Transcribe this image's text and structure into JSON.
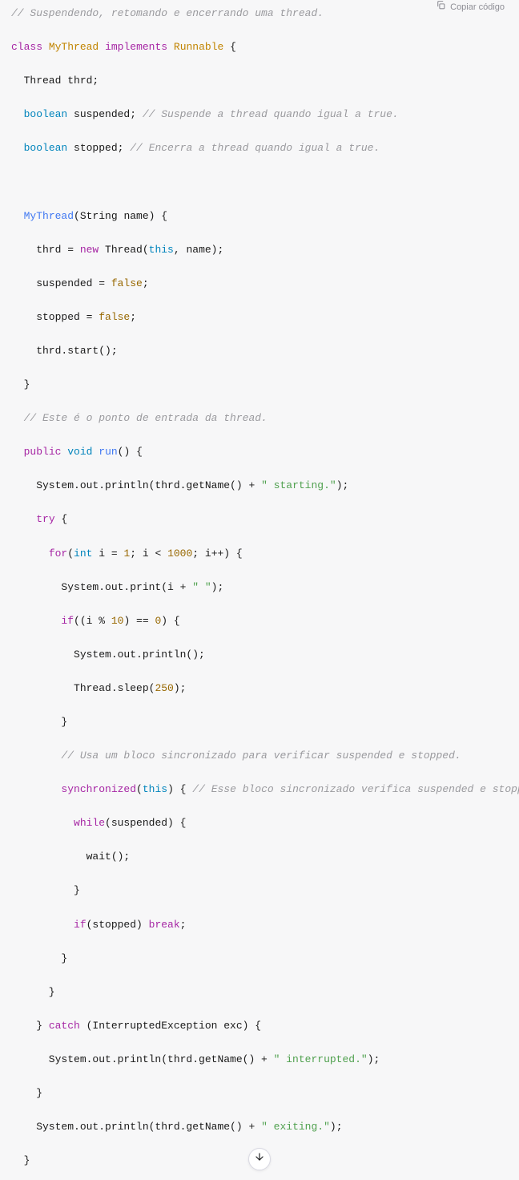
{
  "copy_label": "Copiar código",
  "code": {
    "l1_c": "// Suspendendo, retomando e encerrando uma thread.",
    "l2_kw1": "class",
    "l2_cn": "MyThread",
    "l2_kw2": "implements",
    "l2_rn": "Runnable",
    "l2_rest": " {",
    "l3": "  Thread thrd;",
    "l4_kw": "boolean",
    "l4_mid": " suspended; ",
    "l4_c": "// Suspende a thread quando igual a true.",
    "l5_kw": "boolean",
    "l5_mid": " stopped; ",
    "l5_c": "// Encerra a thread quando igual a true.",
    "l7_fn": "MyThread",
    "l7_rest": "(String name) {",
    "l8_a": "    thrd = ",
    "l8_new": "new",
    "l8_b": " Thread(",
    "l8_this": "this",
    "l8_c": ", name);",
    "l9_a": "    suspended = ",
    "l9_b": "false",
    "l9_c": ";",
    "l10_a": "    stopped = ",
    "l10_b": "false",
    "l10_c": ";",
    "l11": "    thrd.start();",
    "l12": "  }",
    "l13_c": "  // Este é o ponto de entrada da thread.",
    "l14_kw1": "public",
    "l14_kw2": "void",
    "l14_fn": "run",
    "l14_rest": "() {",
    "l15_a": "    System.out.println(thrd.getName() + ",
    "l15_s": "\" starting.\"",
    "l15_b": ");",
    "l16_kw": "try",
    "l16_rest": " {",
    "l17_for": "for",
    "l17_a": "(",
    "l17_int": "int",
    "l17_b": " i = ",
    "l17_n1": "1",
    "l17_c": "; i < ",
    "l17_n2": "1000",
    "l17_d": "; i++) {",
    "l18_a": "        System.out.print(i + ",
    "l18_s": "\" \"",
    "l18_b": ");",
    "l19_if": "if",
    "l19_a": "((i % ",
    "l19_n1": "10",
    "l19_b": ") == ",
    "l19_n2": "0",
    "l19_c": ") {",
    "l20": "          System.out.println();",
    "l21_a": "          Thread.sleep(",
    "l21_n": "250",
    "l21_b": ");",
    "l22": "        }",
    "l23_c": "        // Usa um bloco sincronizado para verificar suspended e stopped.",
    "l24_kw": "synchronized",
    "l24_a": "(",
    "l24_this": "this",
    "l24_b": ") { ",
    "l24_c": "// Esse bloco sincronizado verifica suspended e stopped.",
    "l25_kw": "while",
    "l25_rest": "(suspended) {",
    "l26": "            wait();",
    "l27": "          }",
    "l28_if": "if",
    "l28_a": "(stopped) ",
    "l28_br": "break",
    "l28_b": ";",
    "l29": "        }",
    "l30": "      }",
    "l31_a": "    } ",
    "l31_kw": "catch",
    "l31_b": " (InterruptedException exc) {",
    "l32_a": "      System.out.println(thrd.getName() + ",
    "l32_s": "\" interrupted.\"",
    "l32_b": ");",
    "l33": "    }",
    "l34_a": "    System.out.println(thrd.getName() + ",
    "l34_s": "\" exiting.\"",
    "l34_b": ");",
    "l35": "  }"
  }
}
